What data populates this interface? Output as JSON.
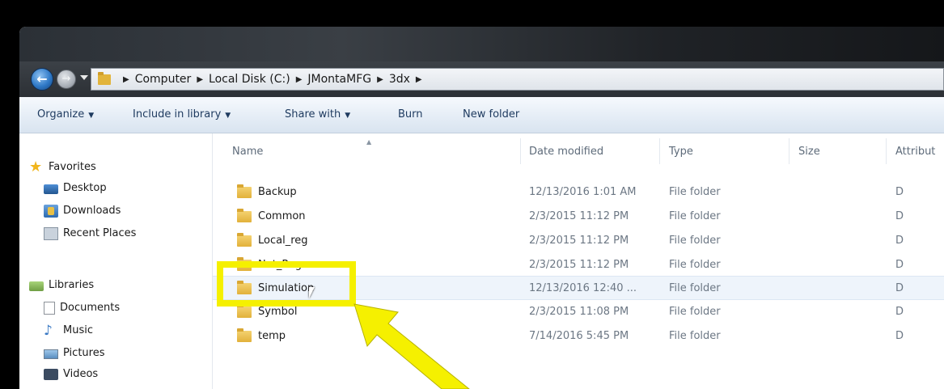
{
  "breadcrumb": [
    "Computer",
    "Local Disk (C:)",
    "JMontaMFG",
    "3dx"
  ],
  "toolbar": {
    "organize": "Organize",
    "include_in_library": "Include in library",
    "share_with": "Share with",
    "burn": "Burn",
    "new_folder": "New folder"
  },
  "nav": {
    "favorites": "Favorites",
    "desktop": "Desktop",
    "downloads": "Downloads",
    "recent_places": "Recent Places",
    "libraries": "Libraries",
    "documents": "Documents",
    "music": "Music",
    "pictures": "Pictures",
    "videos": "Videos"
  },
  "columns": {
    "name": "Name",
    "date_modified": "Date modified",
    "type": "Type",
    "size": "Size",
    "attributes": "Attribut"
  },
  "files": [
    {
      "name": "Backup",
      "date": "12/13/2016 1:01 AM",
      "type": "File folder",
      "attr": "D"
    },
    {
      "name": "Common",
      "date": "2/3/2015 11:12 PM",
      "type": "File folder",
      "attr": "D"
    },
    {
      "name": "Local_reg",
      "date": "2/3/2015 11:12 PM",
      "type": "File folder",
      "attr": "D"
    },
    {
      "name": "Net_Reg",
      "date": "2/3/2015 11:12 PM",
      "type": "File folder",
      "attr": "D"
    },
    {
      "name": "Simulation",
      "date": "12/13/2016 12:40 ...",
      "type": "File folder",
      "attr": "D"
    },
    {
      "name": "Symbol",
      "date": "2/3/2015 11:08 PM",
      "type": "File folder",
      "attr": "D"
    },
    {
      "name": "temp",
      "date": "7/14/2016 5:45 PM",
      "type": "File folder",
      "attr": "D"
    }
  ],
  "colors": {
    "highlight": "#f5f000",
    "toolbar_text": "#1e3a5f",
    "selection": "#eef4fb"
  }
}
